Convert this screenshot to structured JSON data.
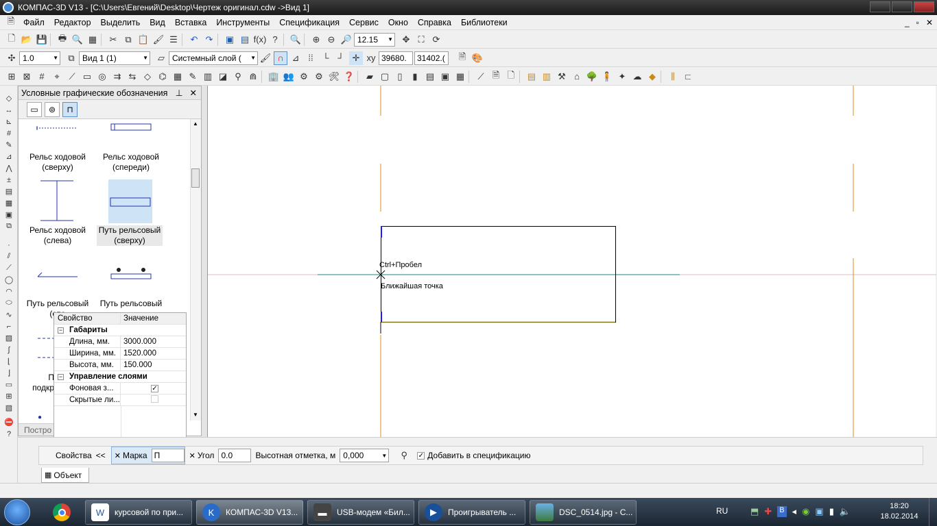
{
  "window": {
    "title": "КОМПАС-3D V13 - [C:\\Users\\Евгений\\Desktop\\Чертеж оригинал.cdw ->Вид 1]"
  },
  "menu": [
    "Файл",
    "Редактор",
    "Выделить",
    "Вид",
    "Вставка",
    "Инструменты",
    "Спецификация",
    "Сервис",
    "Окно",
    "Справка",
    "Библиотеки"
  ],
  "toolbar1": {
    "zoom": "12.15"
  },
  "toolbar2": {
    "step": "1.0",
    "view": "Вид 1 (1)",
    "layer": "Системный слой (",
    "coord_x": "39680.",
    "coord_y": "31402.("
  },
  "panel": {
    "title": "Условные графические обозначения",
    "symbols": [
      {
        "label": "Рельс ходовой (сверху)"
      },
      {
        "label": "Рельс ходовой (спереди)"
      },
      {
        "label": "Рельс ходовой (слева)"
      },
      {
        "label": "Путь рельсовый (сверху)"
      },
      {
        "label": "Путь рельсовый (спе"
      },
      {
        "label": "Путь рельсовый"
      }
    ],
    "partial_labels": [
      "П",
      "подкр",
      "Постро"
    ]
  },
  "props": {
    "col_key": "Свойство",
    "col_val": "Значение",
    "group1": "Габариты",
    "rows1": [
      {
        "k": "Длина, мм.",
        "v": "3000.000"
      },
      {
        "k": "Ширина, мм.",
        "v": "1520.000"
      },
      {
        "k": "Высота, мм.",
        "v": "150.000"
      }
    ],
    "group2": "Управление слоями",
    "rows2": [
      {
        "k": "Фоновая з...",
        "checked": true
      },
      {
        "k": "Скрытые ли...",
        "checked": false
      }
    ]
  },
  "canvas": {
    "hint1": "Ctrl+Пробел",
    "hint2": "Ближайшая точка"
  },
  "propbar": {
    "props_btn": "Свойства",
    "collapse": "<<",
    "mark_label": "Марка",
    "mark_value": "П",
    "angle_label": "Угол",
    "angle_value": "0.0",
    "height_label": "Высотная отметка, м",
    "height_value": "0,000",
    "spec_label": "Добавить в спецификацию",
    "tab": "Объект"
  },
  "taskbar": {
    "items": [
      {
        "label": "курсовой по при..."
      },
      {
        "label": "КОМПАС-3D V13..."
      },
      {
        "label": "USB-модем «Бил..."
      },
      {
        "label": "Проигрыватель ..."
      },
      {
        "label": "DSC_0514.jpg - С..."
      }
    ],
    "lang": "RU",
    "time": "18:20",
    "date": "18.02.2014"
  },
  "colors": {
    "accent": "#4a90d9",
    "orange_line": "#e08a1a",
    "teal_line": "#1a8a7a",
    "blue_mark": "#1a1aff"
  }
}
